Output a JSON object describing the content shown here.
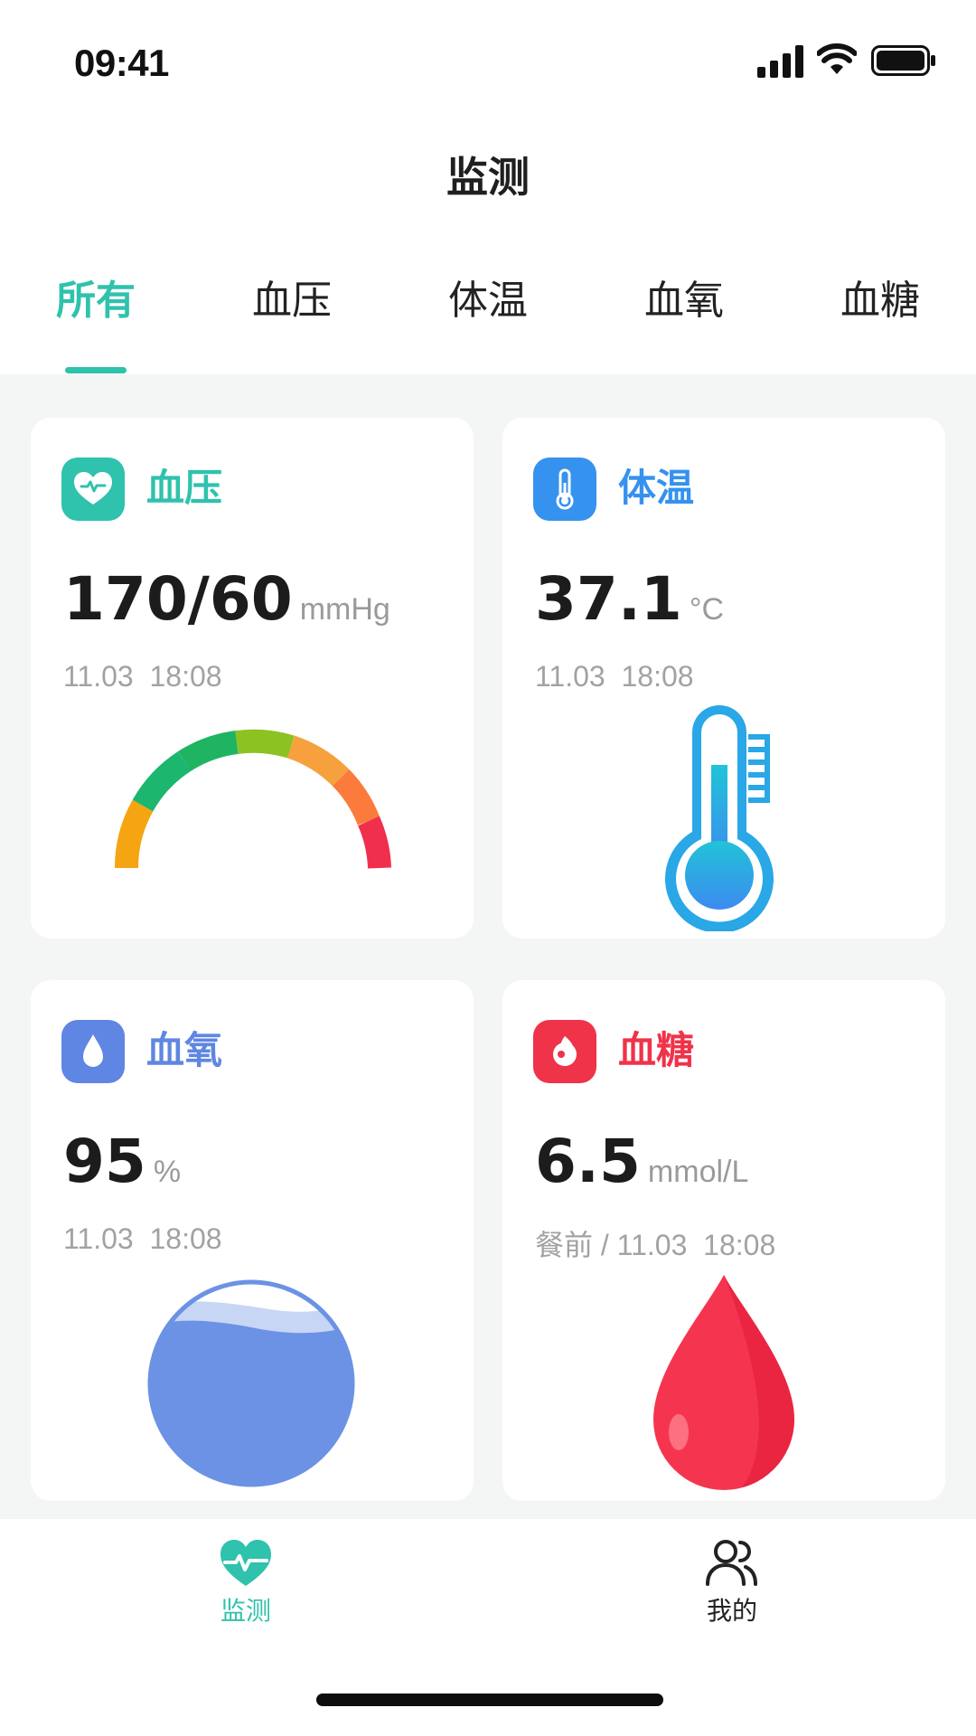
{
  "status_bar": {
    "time": "09:41"
  },
  "nav": {
    "title": "监测"
  },
  "tabs": [
    {
      "label": "所有",
      "active": true
    },
    {
      "label": "血压",
      "active": false
    },
    {
      "label": "体温",
      "active": false
    },
    {
      "label": "血氧",
      "active": false
    },
    {
      "label": "血糖",
      "active": false
    }
  ],
  "cards": {
    "blood_pressure": {
      "title": "血压",
      "value": "170/60",
      "unit": "mmHg",
      "time": "11.03  18:08",
      "icon": "heart-pulse-icon",
      "color": "#2fc2ac"
    },
    "temperature": {
      "title": "体温",
      "value": "37.1",
      "unit": "°C",
      "time": "11.03  18:08",
      "icon": "thermometer-icon",
      "color": "#3592ee"
    },
    "blood_oxygen": {
      "title": "血氧",
      "value": "95",
      "unit": "%",
      "time": "11.03  18:08",
      "icon": "water-drop-icon",
      "color": "#5f86e2"
    },
    "blood_sugar": {
      "title": "血糖",
      "value": "6.5",
      "unit": "mmol/L",
      "time": "餐前 / 11.03  18:08",
      "icon": "blood-drop-icon",
      "color": "#ef3349"
    }
  },
  "tabbar": {
    "items": [
      {
        "label": "监测",
        "icon": "heart-pulse-icon",
        "active": true
      },
      {
        "label": "我的",
        "icon": "users-icon",
        "active": false
      }
    ]
  },
  "colors": {
    "accent": "#2fc2ac",
    "background": "#f4f5f5",
    "text_secondary": "#a2a2a2"
  }
}
